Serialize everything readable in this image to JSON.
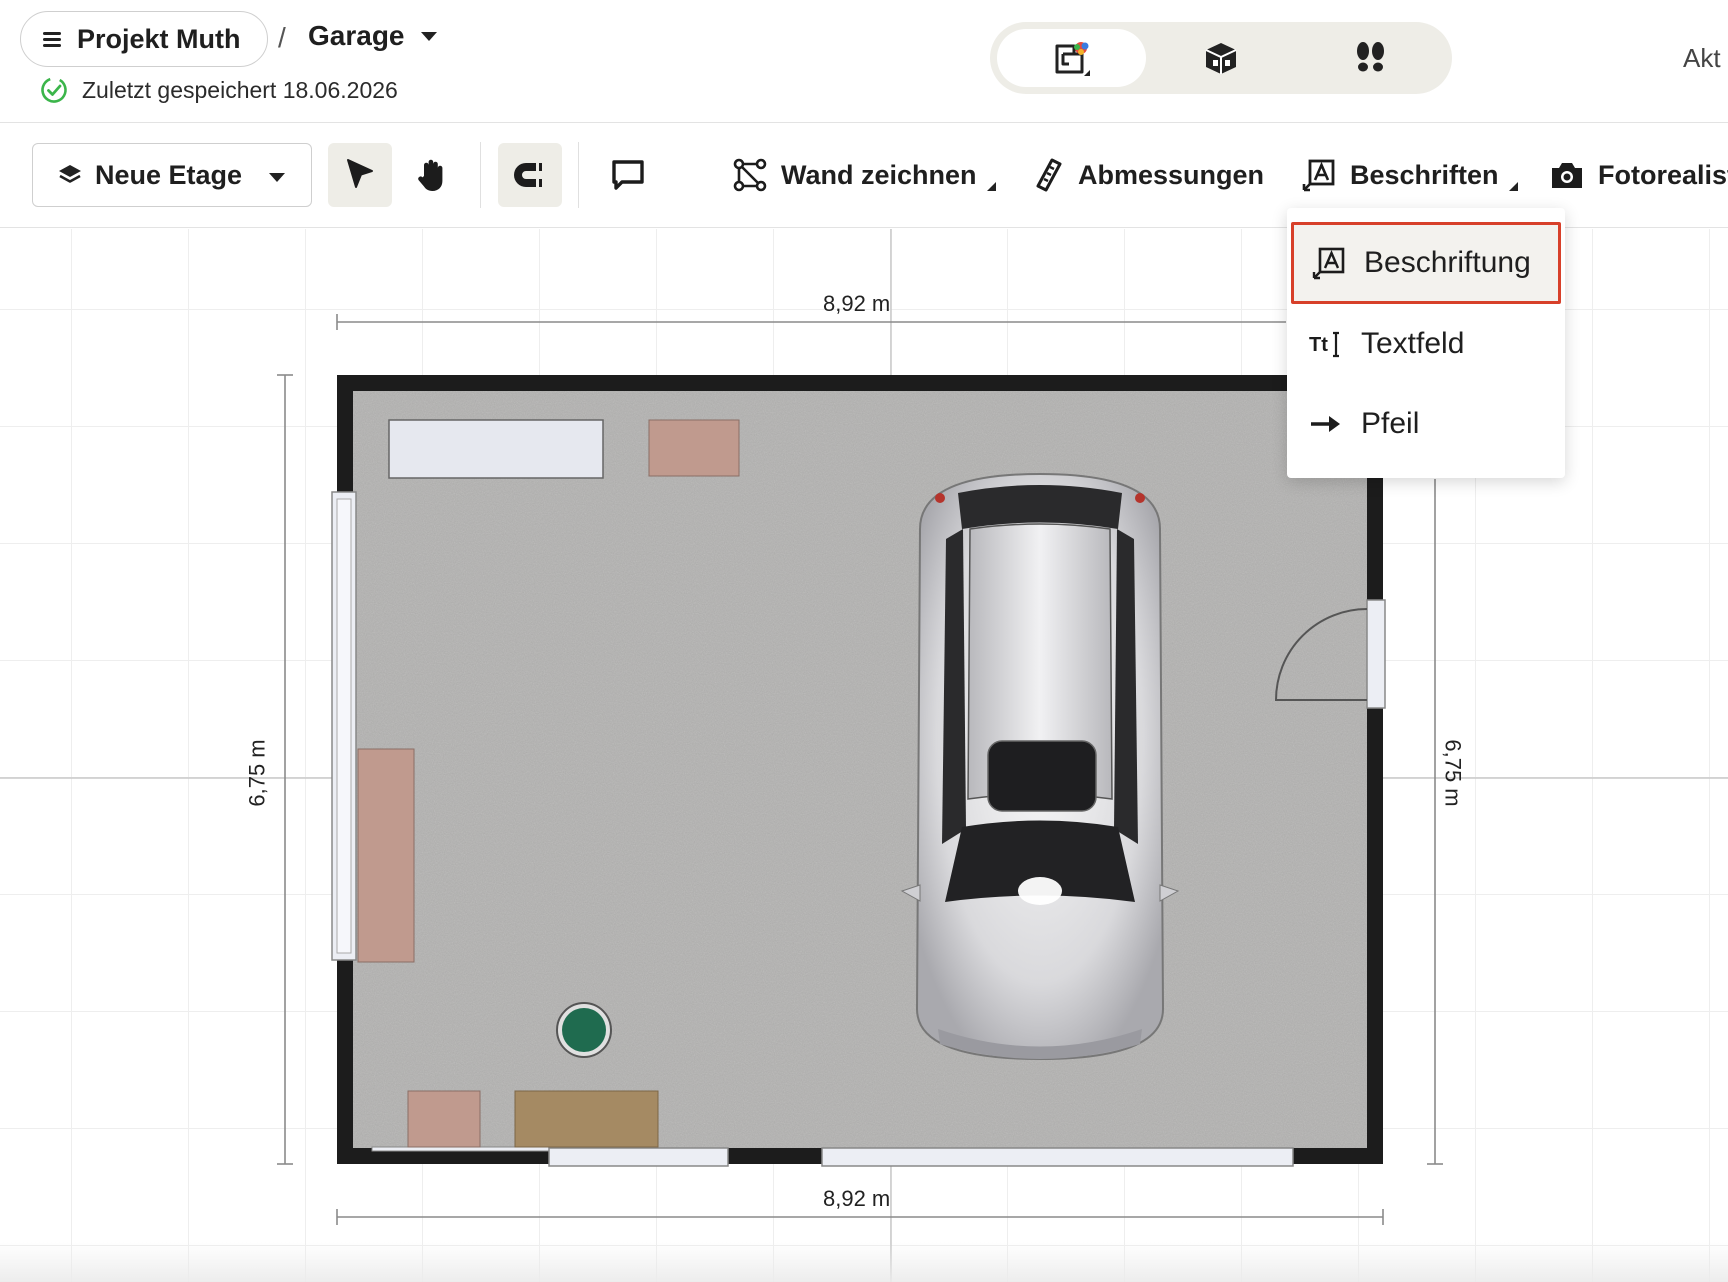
{
  "header": {
    "project_name": "Projekt Muth",
    "breadcrumb_separator": "/",
    "floor_name": "Garage",
    "save_status": "Zuletzt gespeichert 18.06.2026",
    "truncated_right_text": "Akt"
  },
  "view_modes": [
    {
      "icon": "2d-plan-icon",
      "active": true
    },
    {
      "icon": "3d-box-icon",
      "active": false
    },
    {
      "icon": "footsteps-icon",
      "active": false
    }
  ],
  "toolbar": {
    "floor_select_label": "Neue Etage",
    "draw_wall_label": "Wand zeichnen",
    "dimensions_label": "Abmessungen",
    "labels_label": "Beschriften",
    "photo_label": "Fotorealist"
  },
  "labels_menu": {
    "items": [
      {
        "label": "Beschriftung",
        "icon": "label-icon",
        "highlighted": true
      },
      {
        "label": "Textfeld",
        "icon": "textfield-icon",
        "highlighted": false
      },
      {
        "label": "Pfeil",
        "icon": "arrow-right-icon",
        "highlighted": false
      }
    ]
  },
  "floorplan": {
    "width_label_top": "8,92 m",
    "width_label_bottom": "8,92 m",
    "height_label_left": "6,75 m",
    "height_label_right": "6,75 m"
  },
  "colors": {
    "accent_highlight": "#d7402a",
    "status_ok": "#3bb54a",
    "wall": "#1c1c1c",
    "floor": "#b3b2b1",
    "furniture_pink": "#c09a8e",
    "furniture_wood": "#a58a63",
    "plant": "#1f6b4f"
  }
}
